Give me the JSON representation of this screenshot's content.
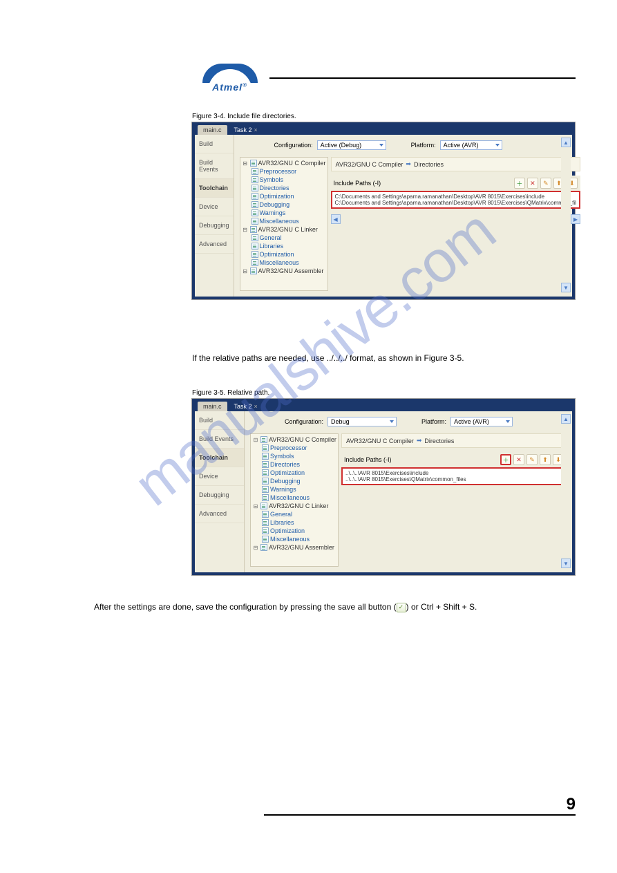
{
  "logo": {
    "text": "Atmel",
    "reg": "®"
  },
  "figure1": {
    "caption": "Figure 3-4. Include file directories."
  },
  "figure2": {
    "caption": "Figure 3-5. Relative path."
  },
  "note_text": "If the relative paths are needed, use ../../../ format, as shown in Figure 3-5.",
  "instruction_text": "After the settings are done, save the configuration by pressing the save all button ( ) or Ctrl + Shift + S.",
  "footer": {
    "pagenum": "9"
  },
  "screenshot": {
    "tabs": {
      "main": "main.c",
      "active": "Task 2"
    },
    "sidebar": [
      "Build",
      "Build Events",
      "Toolchain",
      "Device",
      "Debugging",
      "Advanced"
    ],
    "config_label": "Configuration:",
    "platform_label": "Platform:",
    "platform_value": "Active (AVR)",
    "breadcrumb": {
      "root": "AVR32/GNU C Compiler",
      "leaf": "Directories"
    },
    "list_header": "Include Paths (-I)",
    "tree": {
      "compiler": "AVR32/GNU C Compiler",
      "items": [
        "Preprocessor",
        "Symbols",
        "Directories",
        "Optimization",
        "Debugging",
        "Warnings",
        "Miscellaneous"
      ],
      "linker": "AVR32/GNU C Linker",
      "linker_items": [
        "General",
        "Libraries",
        "Optimization",
        "Miscellaneous"
      ],
      "assembler": "AVR32/GNU Assembler"
    }
  },
  "ss1": {
    "config_value": "Active (Debug)",
    "paths": [
      "C:\\Documents and Settings\\aparna.ramanathan\\Desktop\\AVR 8015\\Exercises\\include",
      "C:\\Documents and Settings\\aparna.ramanathan\\Desktop\\AVR 8015\\Exercises\\QMatrix\\common_fil"
    ]
  },
  "ss2": {
    "config_value": "Debug",
    "paths": [
      "..\\..\\..\\AVR 8015\\Exercises\\include",
      "..\\..\\..\\AVR 8015\\Exercises\\QMatrix\\common_files"
    ]
  }
}
